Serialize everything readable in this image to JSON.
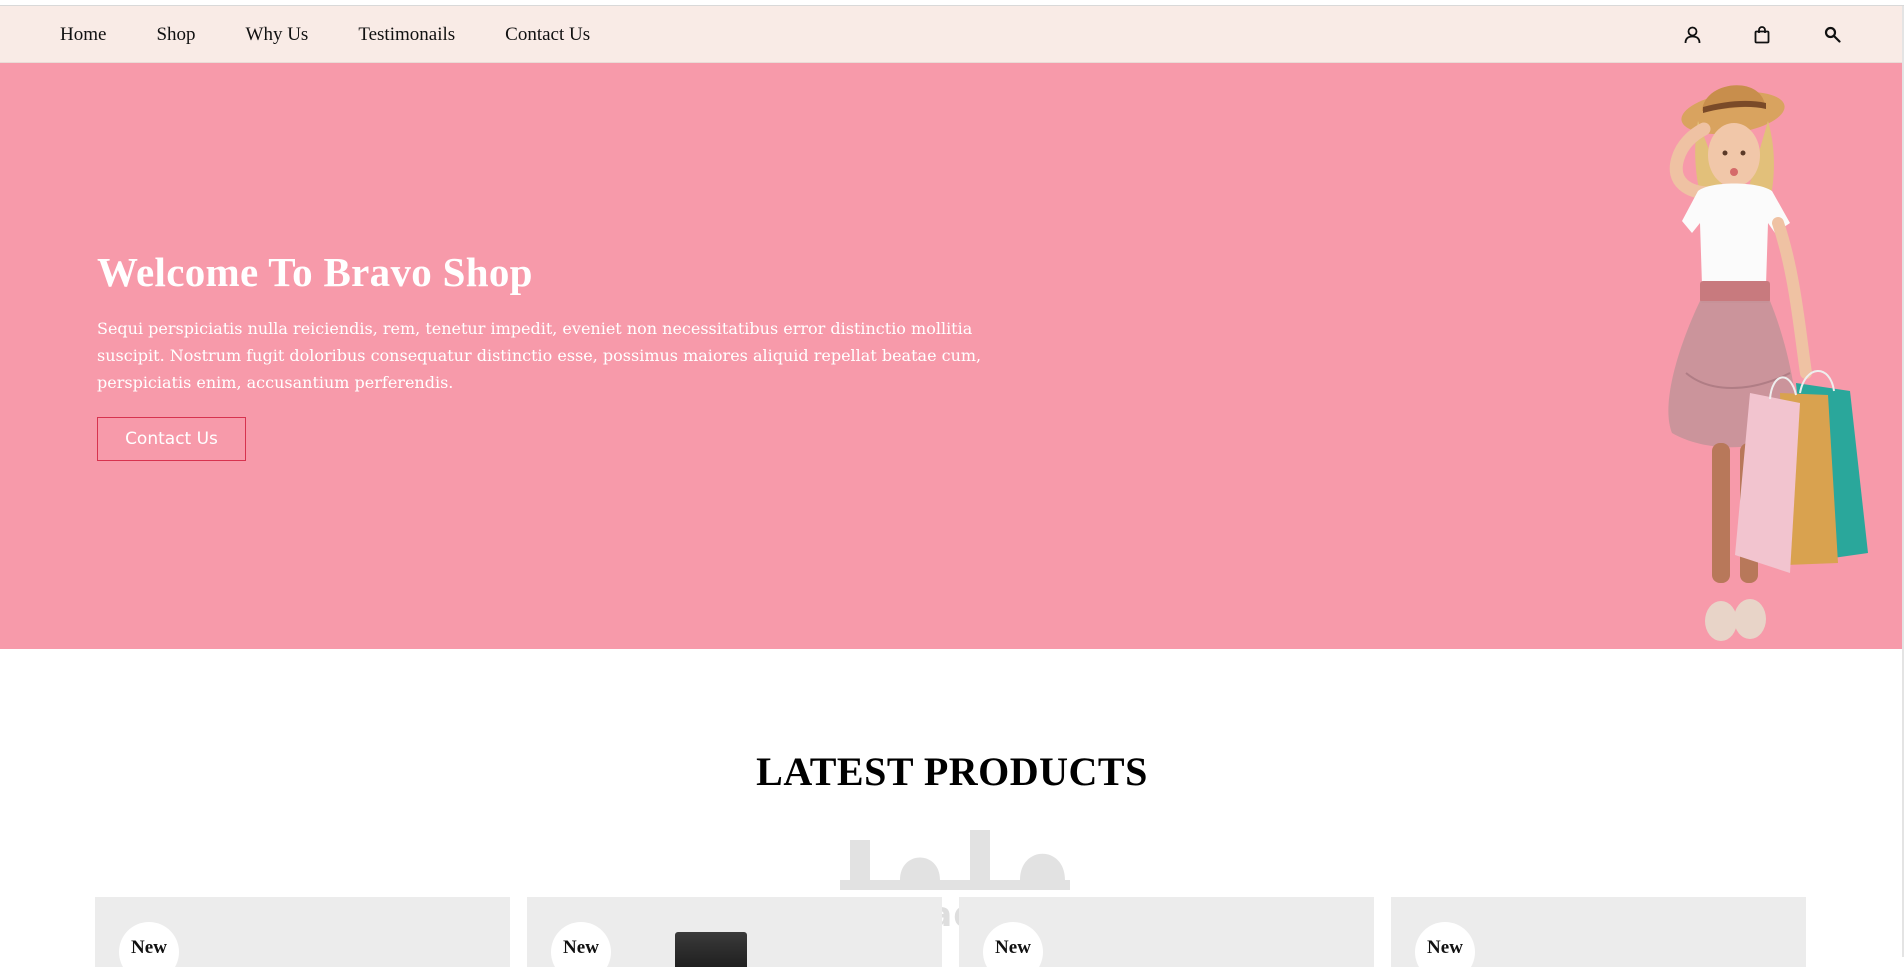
{
  "nav": {
    "links": [
      "Home",
      "Shop",
      "Why Us",
      "Testimonails",
      "Contact Us"
    ],
    "icons": [
      "user-icon",
      "shopping-bag-icon",
      "search-icon"
    ]
  },
  "hero": {
    "title": "Welcome To Bravo Shop",
    "text": "Sequi perspiciatis nulla reiciendis, rem, tenetur impedit, eveniet non necessitatibus error distinctio mollitia suscipit. Nostrum fugit doloribus consequatur distinctio esse, possimus maiores aliquid repellat beatae cum, perspiciatis enim, accusantium perferendis.",
    "button_label": "Contact Us"
  },
  "products": {
    "title": "LATEST PRODUCTS",
    "cards": [
      {
        "badge": "New"
      },
      {
        "badge": "New"
      },
      {
        "badge": "New"
      },
      {
        "badge": "New"
      }
    ]
  },
  "watermark": {
    "arabic": "مستقل",
    "latin": "mostaql.com"
  },
  "colors": {
    "nav_bg": "#f9ebe6",
    "hero_bg": "#f79aaa",
    "accent": "#d7334f",
    "card_bg": "#ececec"
  }
}
